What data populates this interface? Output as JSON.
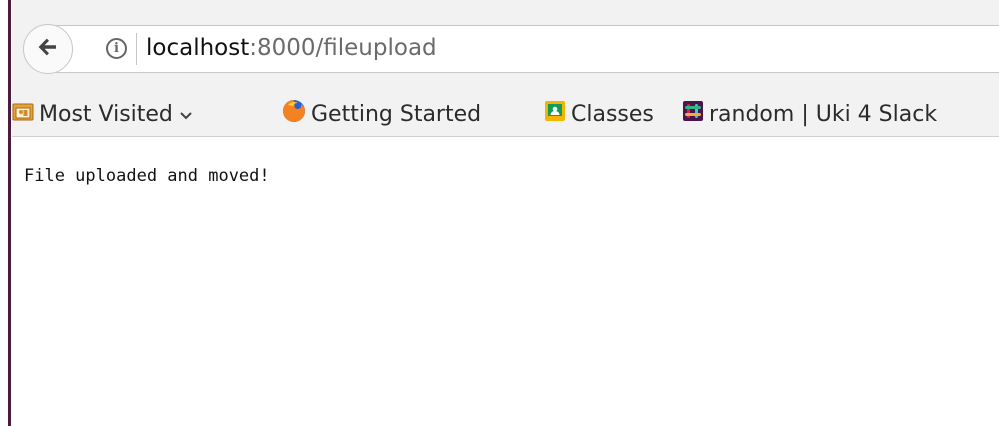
{
  "browser": {
    "url_host": "localhost",
    "url_rest": ":8000/fileupload",
    "icons": {
      "back": "back-arrow-icon",
      "info": "info-icon"
    }
  },
  "bookmarks": [
    {
      "label": "Most Visited",
      "icon": "folder-icon",
      "has_dropdown": true
    },
    {
      "label": "Getting Started",
      "icon": "firefox-icon"
    },
    {
      "label": "Classes",
      "icon": "classroom-icon"
    },
    {
      "label": "random | Uki 4 Slack",
      "icon": "slack-icon"
    }
  ],
  "page": {
    "message": "File uploaded and moved!"
  },
  "colors": {
    "toolbar_bg": "#f2f2f2",
    "window_border": "#4a1b3f",
    "url_host": "#111111",
    "url_rest": "#6a6a6a"
  }
}
